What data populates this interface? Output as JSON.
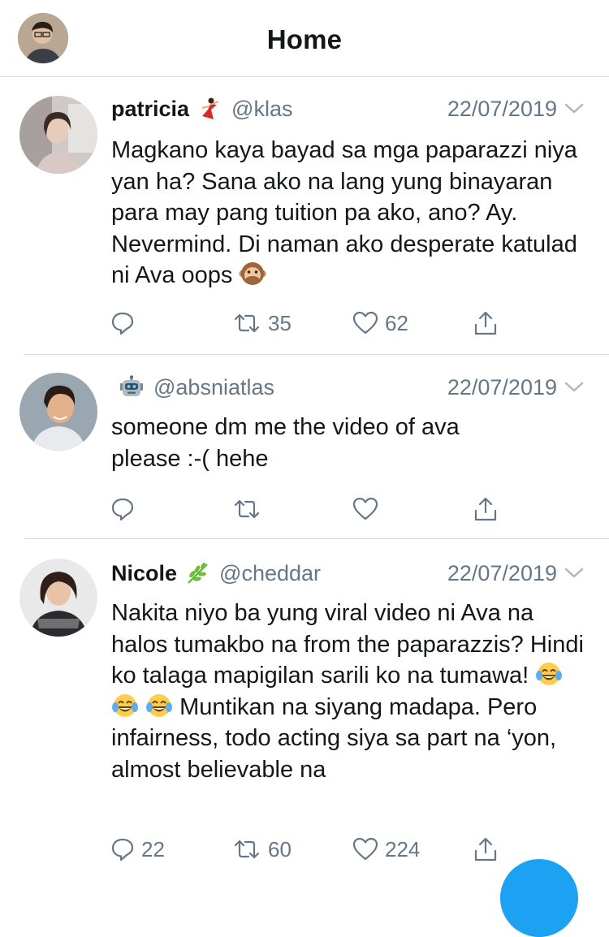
{
  "header": {
    "title": "Home"
  },
  "tweets": [
    {
      "name": "patricia",
      "name_emoji": "dancer-emoji",
      "handle": "@klas",
      "date": "22/07/2019",
      "text": "Magkano kaya bayad sa mga paparazzi niya yan ha? Sana ako na lang yung binayaran para may pang tuition pa ako, ano? Ay. Nevermind. Di naman ako desperate katulad ni Ava oops",
      "text_emoji": "speak-no-evil-monkey-emoji",
      "replies": "",
      "retweets": "35",
      "likes": "62"
    },
    {
      "name": "",
      "name_emoji": "robot-emoji",
      "handle": "@absniatlas",
      "date": "22/07/2019",
      "text": "someone dm me the video of ava please :-( hehe",
      "replies": "",
      "retweets": "",
      "likes": ""
    },
    {
      "name": "Nicole",
      "name_emoji": "herb-emoji",
      "handle": "@cheddar",
      "date": "22/07/2019",
      "text_a": "Nakita niyo ba yung viral video ni Ava na halos tumakbo na from the paparazzis? Hindi ko talaga mapigilan sarili ko na tumawa!",
      "text_emoji": "tears-of-joy-emoji",
      "text_b": "Muntikan na siyang madapa. Pero infairness, todo acting siya sa part na ‘yon, almost believable na",
      "replies": "22",
      "retweets": "60",
      "likes": "224"
    }
  ],
  "colors": {
    "accent": "#1da1f2",
    "muted": "#657786",
    "text": "#14171a",
    "divider": "#d6d9dc"
  }
}
